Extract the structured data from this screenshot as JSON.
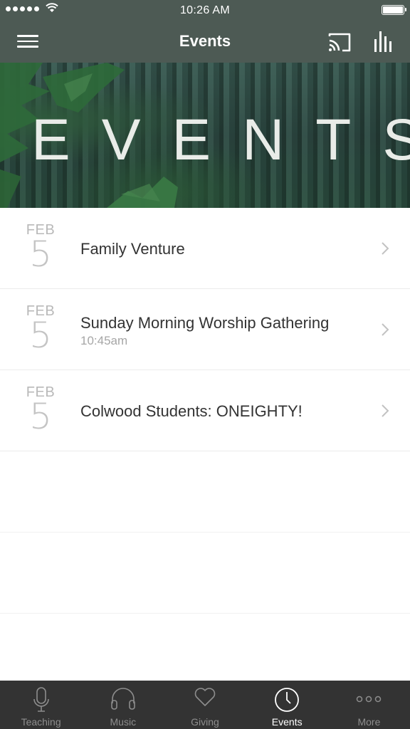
{
  "status_bar": {
    "time": "10:26 AM"
  },
  "nav": {
    "title": "Events"
  },
  "banner": {
    "title": "EVENTS"
  },
  "events": [
    {
      "month": "FEB",
      "day": "5",
      "title": "Family Venture",
      "time": ""
    },
    {
      "month": "FEB",
      "day": "5",
      "title": "Sunday Morning Worship Gathering",
      "time": "10:45am"
    },
    {
      "month": "FEB",
      "day": "5",
      "title": "Colwood Students: ONEIGHTY!",
      "time": ""
    }
  ],
  "tabs": [
    {
      "label": "Teaching",
      "icon": "microphone-icon",
      "active": false
    },
    {
      "label": "Music",
      "icon": "headphones-icon",
      "active": false
    },
    {
      "label": "Giving",
      "icon": "heart-icon",
      "active": false
    },
    {
      "label": "Events",
      "icon": "clock-icon",
      "active": true
    },
    {
      "label": "More",
      "icon": "more-dots-icon",
      "active": false
    }
  ],
  "colors": {
    "header": "#4d5a54",
    "tab_bar": "#333333",
    "tab_active": "#ffffff",
    "tab_inactive": "#8d8d8d"
  }
}
